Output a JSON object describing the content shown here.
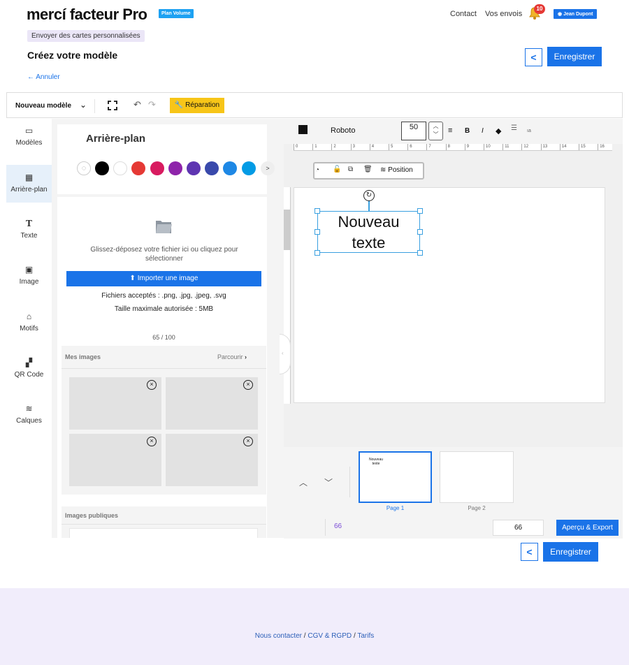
{
  "header": {
    "logo": "mercí facteur Pro",
    "plan_badge": "Plan Volume",
    "contact": "Contact",
    "envois": "Vos envois",
    "notifications": "10",
    "user": "Jean Dupont"
  },
  "page": {
    "subtitle_tag": "Envoyer des cartes personnalisées",
    "title": "Créez votre modèle",
    "cancel": "← Annuler",
    "back_label": "<",
    "save_label": "Enregistrer"
  },
  "toolbar": {
    "model_select": "Nouveau modèle",
    "repair": "Réparation"
  },
  "sidebar": {
    "items": [
      {
        "label": "Modèles",
        "icon": "templates-icon"
      },
      {
        "label": "Arrière-plan",
        "icon": "background-icon",
        "active": true
      },
      {
        "label": "Texte",
        "icon": "text-icon"
      },
      {
        "label": "Image",
        "icon": "image-icon"
      },
      {
        "label": "Motifs",
        "icon": "shapes-icon"
      },
      {
        "label": "QR Code",
        "icon": "qrcode-icon"
      },
      {
        "label": "Calques",
        "icon": "layers-icon"
      }
    ]
  },
  "panel": {
    "title": "Arrière-plan",
    "colors": [
      "#000000",
      "#ffffff",
      "#e53935",
      "#d81b60",
      "#8e24aa",
      "#5e35b1",
      "#3949ab",
      "#1e88e5",
      "#039be5"
    ],
    "more_colors": ">",
    "drop_text": "Glissez-déposez votre fichier ici ou cliquez pour sélectionner",
    "import_button": "Importer une image",
    "accepted_files": "Fichiers acceptés : .png, .jpg, .jpeg, .svg",
    "max_size": "Taille maximale autorisée : 5MB",
    "usage_count": "65 / 100",
    "my_images_title": "Mes images",
    "browse": "Parcourir",
    "public_images_title": "Images publiques"
  },
  "editor": {
    "font_color": "#000000",
    "font_name": "Roboto",
    "font_size": "50",
    "ruler_ticks": [
      "0",
      "1",
      "2",
      "3",
      "4",
      "5",
      "6",
      "7",
      "8",
      "9",
      "10",
      "11",
      "12",
      "13",
      "14",
      "15",
      "16"
    ],
    "context_position": "Position",
    "text_line1": "Nouveau",
    "text_line2": "texte"
  },
  "pages": {
    "page1_thumb": "Nouveau texte",
    "page1_label": "Page 1",
    "page2_label": "Page 2",
    "page_count": "66",
    "zoom": "66",
    "export_button": "Aperçu & Export"
  },
  "footer": {
    "contact": "Nous contacter",
    "cgv": "CGV & RGPD",
    "tarifs": "Tarifs",
    "separator": "/"
  },
  "colors": {
    "accent": "#1a73e8",
    "repair_yellow": "#f7c518",
    "footer_bg": "#f1edfb"
  }
}
